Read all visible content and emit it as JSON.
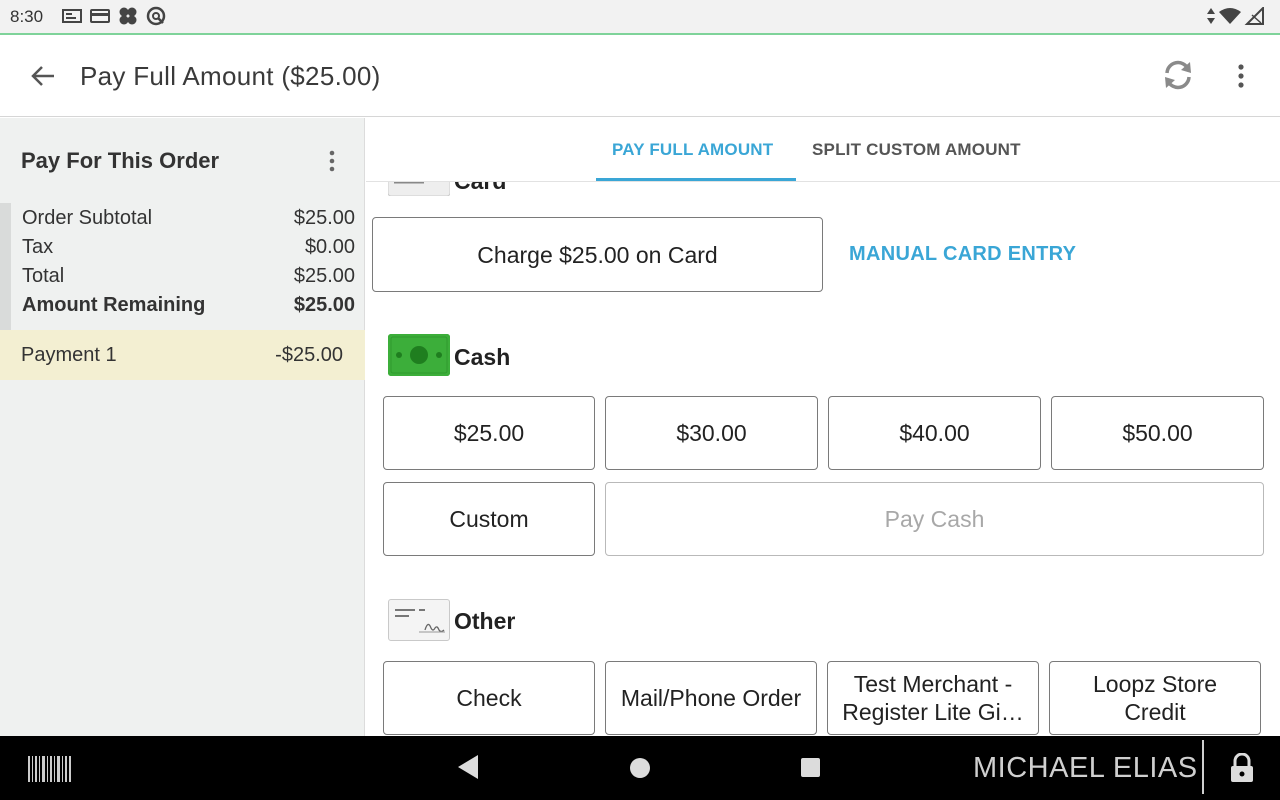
{
  "status_bar": {
    "time": "8:30",
    "icons": [
      "notification-icon",
      "card-icon",
      "clover-icon",
      "sync-icon",
      "data-arrows-icon",
      "wifi-icon",
      "signal-icon"
    ]
  },
  "app_bar": {
    "title": "Pay Full Amount ($25.00)",
    "back_icon": "back-arrow-icon",
    "refresh_icon": "refresh-icon",
    "more_icon": "more-vert-icon"
  },
  "order_panel": {
    "title": "Pay For This Order",
    "summary": [
      {
        "label": "Order Subtotal",
        "value": "$25.00",
        "bold": false
      },
      {
        "label": "Tax",
        "value": "$0.00",
        "bold": false
      },
      {
        "label": "Total",
        "value": "$25.00",
        "bold": false
      },
      {
        "label": "Amount Remaining",
        "value": "$25.00",
        "bold": true
      }
    ],
    "payments": [
      {
        "label": "Payment 1",
        "value": "-$25.00"
      }
    ]
  },
  "tabs": [
    {
      "label": "PAY FULL AMOUNT",
      "active": true
    },
    {
      "label": "SPLIT CUSTOM AMOUNT",
      "active": false
    }
  ],
  "card_section": {
    "label": "Card",
    "charge_button": "Charge $25.00 on Card",
    "manual_link": "MANUAL CARD ENTRY"
  },
  "cash_section": {
    "label": "Cash",
    "amounts": [
      "$25.00",
      "$30.00",
      "$40.00",
      "$50.00"
    ],
    "custom_button": "Custom",
    "pay_cash_button": "Pay Cash"
  },
  "other_section": {
    "label": "Other",
    "tenders": [
      "Check",
      "Mail/Phone Order",
      "Test Merchant - Register Lite Gi…",
      "Loopz Store Credit"
    ]
  },
  "nav_bar": {
    "user": "MICHAEL ELIAS"
  },
  "colors": {
    "accent": "#3aa6d6",
    "payment_highlight": "#f3efd2",
    "cash_green": "#3cae3a",
    "status_line": "#7fd39a"
  }
}
